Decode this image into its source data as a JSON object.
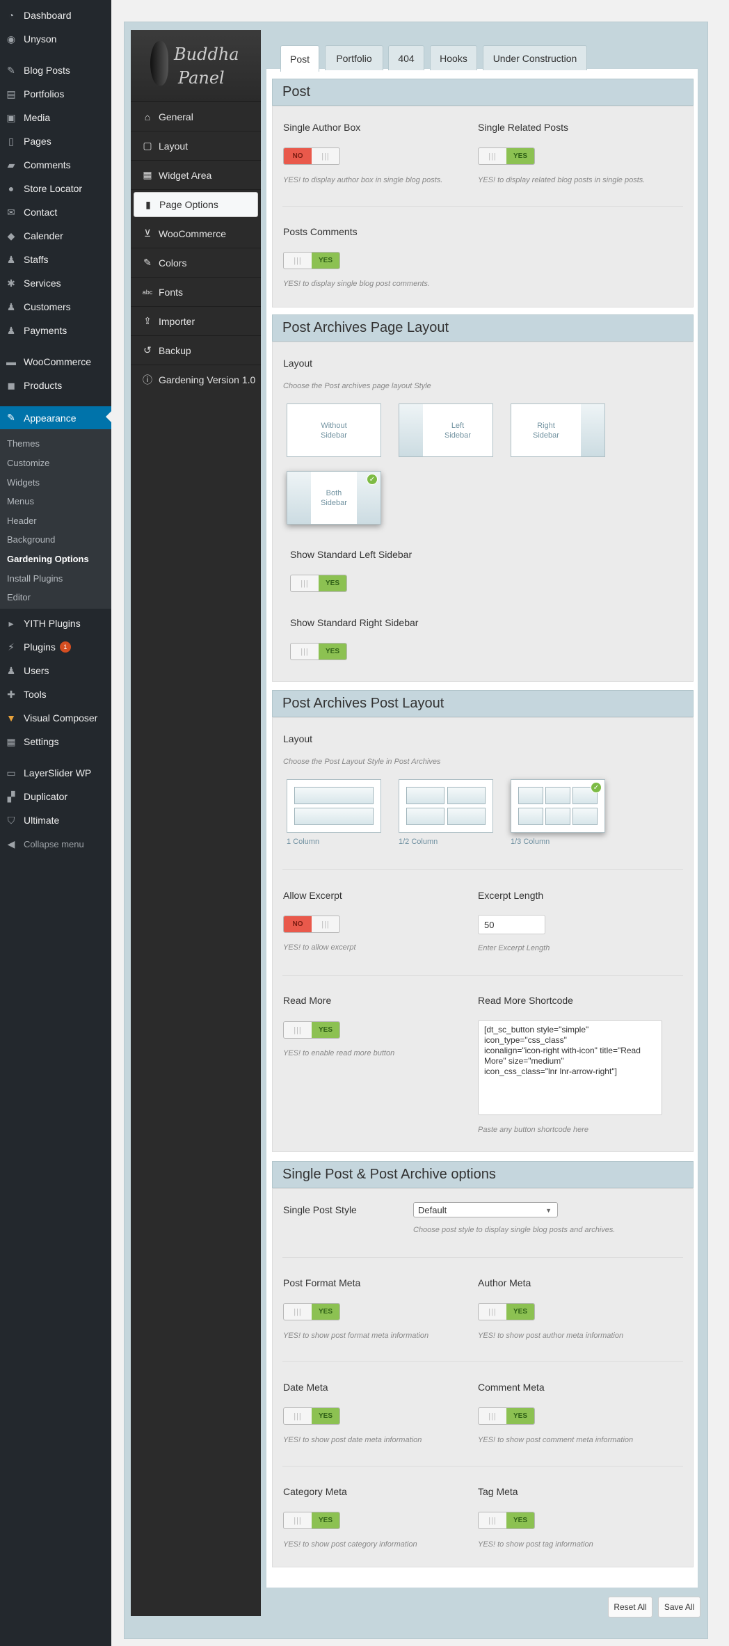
{
  "wp_menu": {
    "items": [
      {
        "label": "Dashboard",
        "icon": "dashboard-icon"
      },
      {
        "label": "Unyson",
        "icon": "unyson-icon"
      },
      {
        "label": "Blog Posts",
        "icon": "pin-icon"
      },
      {
        "label": "Portfolios",
        "icon": "portfolio-icon"
      },
      {
        "label": "Media",
        "icon": "media-icon"
      },
      {
        "label": "Pages",
        "icon": "pages-icon"
      },
      {
        "label": "Comments",
        "icon": "comments-icon"
      },
      {
        "label": "Store Locator",
        "icon": "location-icon"
      },
      {
        "label": "Contact",
        "icon": "envelope-icon"
      },
      {
        "label": "Calender",
        "icon": "calendar-icon"
      },
      {
        "label": "Staffs",
        "icon": "staff-icon"
      },
      {
        "label": "Services",
        "icon": "services-icon"
      },
      {
        "label": "Customers",
        "icon": "customers-icon"
      },
      {
        "label": "Payments",
        "icon": "payments-icon"
      },
      {
        "label": "WooCommerce",
        "icon": "woocommerce-icon"
      },
      {
        "label": "Products",
        "icon": "products-icon"
      },
      {
        "label": "Appearance",
        "icon": "brush-icon"
      },
      {
        "label": "YITH Plugins",
        "icon": "yith-icon"
      },
      {
        "label": "Plugins",
        "icon": "plugins-icon"
      },
      {
        "label": "Users",
        "icon": "users-icon"
      },
      {
        "label": "Tools",
        "icon": "wrench-icon"
      },
      {
        "label": "Visual Composer",
        "icon": "visual-composer-icon"
      },
      {
        "label": "Settings",
        "icon": "settings-icon"
      },
      {
        "label": "LayerSlider WP",
        "icon": "layers-icon"
      },
      {
        "label": "Duplicator",
        "icon": "duplicator-icon"
      },
      {
        "label": "Ultimate",
        "icon": "shield-icon"
      },
      {
        "label": "Collapse menu",
        "icon": "collapse-icon"
      }
    ],
    "plugins_badge": "1",
    "appearance_sub": [
      "Themes",
      "Customize",
      "Widgets",
      "Menus",
      "Header",
      "Background",
      "Gardening Options",
      "Install Plugins",
      "Editor"
    ]
  },
  "framework": {
    "logo_line1": "Buddha",
    "logo_line2": "Panel",
    "nav": [
      {
        "label": "General",
        "icon": "home-icon"
      },
      {
        "label": "Layout",
        "icon": "layout-icon"
      },
      {
        "label": "Widget Area",
        "icon": "widget-icon"
      },
      {
        "label": "Page Options",
        "icon": "page-icon"
      },
      {
        "label": "WooCommerce",
        "icon": "cart-icon"
      },
      {
        "label": "Colors",
        "icon": "brush-icon"
      },
      {
        "label": "Fonts",
        "icon": "fonts-icon"
      },
      {
        "label": "Importer",
        "icon": "import-icon"
      },
      {
        "label": "Backup",
        "icon": "backup-icon"
      },
      {
        "label": "Gardening Version 1.0",
        "icon": "info-icon"
      }
    ]
  },
  "tabs": [
    "Post",
    "Portfolio",
    "404",
    "Hooks",
    "Under Construction"
  ],
  "toggle": {
    "yes": "YES",
    "no": "NO"
  },
  "section_post": {
    "title": "Post",
    "single_author_box": {
      "label": "Single Author Box",
      "value": "NO",
      "desc": "YES! to display author box in single blog posts."
    },
    "single_related": {
      "label": "Single Related Posts",
      "value": "YES",
      "desc": "YES! to display related blog posts in single posts."
    },
    "posts_comments": {
      "label": "Posts Comments",
      "value": "YES",
      "desc": "YES! to display single blog post comments."
    }
  },
  "section_archive_layout": {
    "title": "Post Archives Page Layout",
    "layout_label": "Layout",
    "layout_desc": "Choose the Post archives page layout Style",
    "options": [
      {
        "line1": "Without",
        "line2": "Sidebar"
      },
      {
        "line1": "Left",
        "line2": "Sidebar"
      },
      {
        "line1": "Right",
        "line2": "Sidebar"
      },
      {
        "line1": "Both",
        "line2": "Sidebar"
      }
    ],
    "selected": "Both Sidebar",
    "show_left": {
      "label": "Show Standard Left Sidebar",
      "value": "YES"
    },
    "show_right": {
      "label": "Show Standard Right Sidebar",
      "value": "YES"
    }
  },
  "section_archive_post": {
    "title": "Post Archives Post Layout",
    "layout_label": "Layout",
    "layout_desc": "Choose the Post Layout Style in Post Archives",
    "options": [
      "1 Column",
      "1/2 Column",
      "1/3 Column"
    ],
    "selected": "1/3 Column",
    "allow_excerpt": {
      "label": "Allow Excerpt",
      "value": "NO",
      "desc": "YES! to allow excerpt"
    },
    "excerpt_length": {
      "label": "Excerpt Length",
      "value": "50",
      "desc": "Enter Excerpt Length"
    },
    "read_more": {
      "label": "Read More",
      "value": "YES",
      "desc": "YES! to enable read more button"
    },
    "read_more_shortcode": {
      "label": "Read More Shortcode",
      "value": "[dt_sc_button style=\"simple\"\nicon_type=\"css_class\"\niconalign=\"icon-right with-icon\" title=\"Read\nMore\" size=\"medium\"\nicon_css_class=\"lnr lnr-arrow-right\"]",
      "desc": "Paste any button shortcode here"
    }
  },
  "section_single": {
    "title": "Single Post & Post Archive options",
    "style": {
      "label": "Single Post Style",
      "value": "Default",
      "desc": "Choose post style to display single blog posts and archives."
    },
    "post_format_meta": {
      "label": "Post Format Meta",
      "value": "YES",
      "desc": "YES! to show post format meta information"
    },
    "author_meta": {
      "label": "Author Meta",
      "value": "YES",
      "desc": "YES! to show post author meta information"
    },
    "date_meta": {
      "label": "Date Meta",
      "value": "YES",
      "desc": "YES! to show post date meta information"
    },
    "comment_meta": {
      "label": "Comment Meta",
      "value": "YES",
      "desc": "YES! to show post comment meta information"
    },
    "category_meta": {
      "label": "Category Meta",
      "value": "YES",
      "desc": "YES! to show post category information"
    },
    "tag_meta": {
      "label": "Tag Meta",
      "value": "YES",
      "desc": "YES! to show post tag information"
    }
  },
  "actions": {
    "reset": "Reset All",
    "save": "Save All"
  },
  "colors": {
    "wp_admin": "#23282d",
    "accent": "#0073aa",
    "toggle_yes": "#8cc152",
    "toggle_no": "#e9594b",
    "panel_header": "#c5d6dd"
  }
}
